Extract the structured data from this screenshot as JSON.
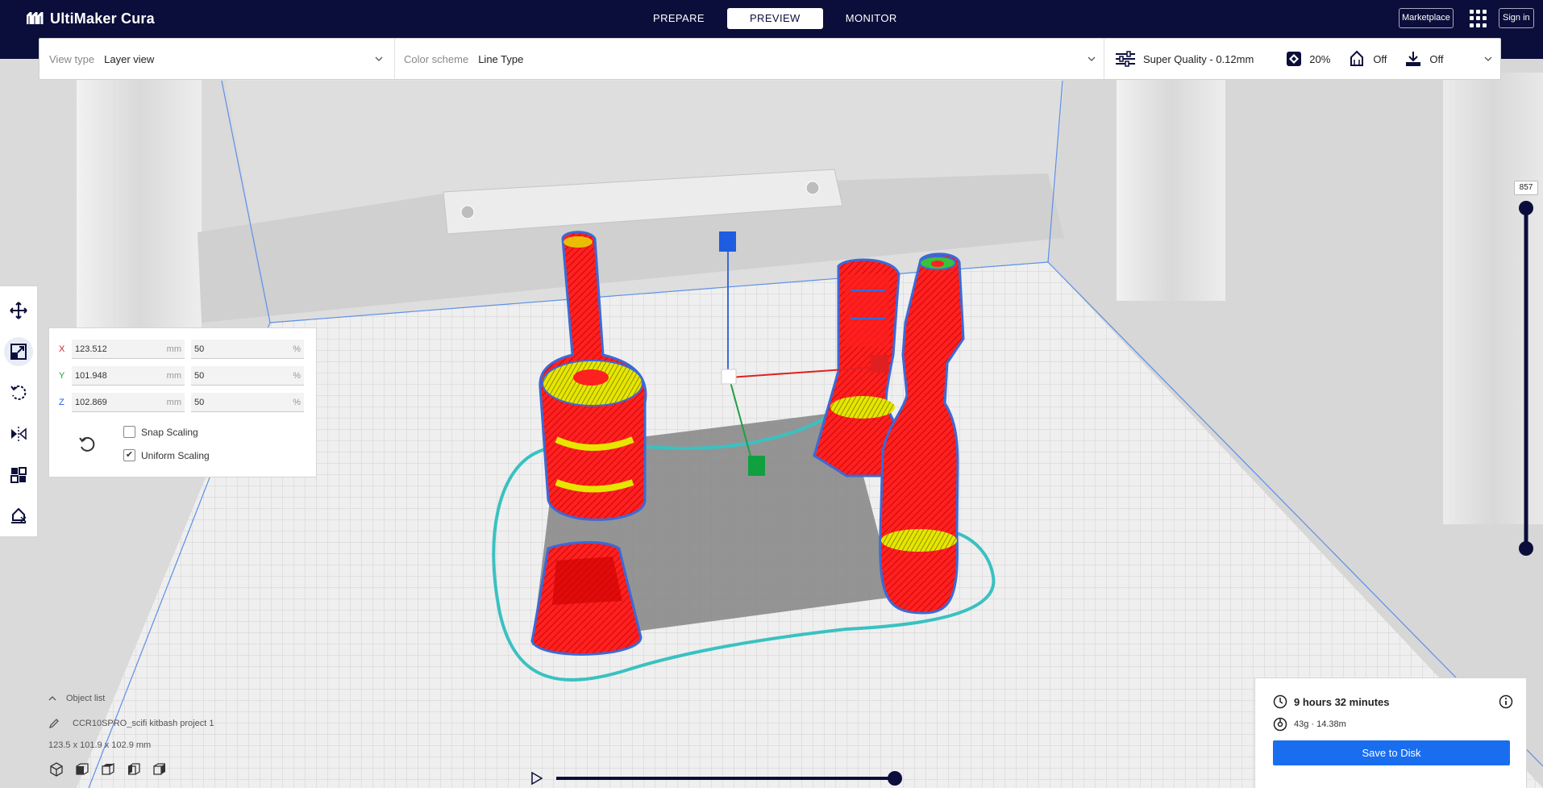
{
  "app": {
    "title": "UltiMaker Cura",
    "logo_icon": "ultimaker-logo-icon"
  },
  "stages": {
    "prepare": "PREPARE",
    "preview": "PREVIEW",
    "monitor": "MONITOR",
    "selected": "PREVIEW"
  },
  "topbar_right": {
    "marketplace": "Marketplace",
    "apps_icon": "grid-apps-icon",
    "sign_in": "Sign in"
  },
  "header": {
    "view_type_label": "View type",
    "view_type_value": "Layer view",
    "color_scheme_label": "Color scheme",
    "color_scheme_value": "Line Type",
    "profile": "Super Quality - 0.12mm",
    "infill": "20%",
    "support": "Off",
    "adhesion": "Off"
  },
  "tools": [
    "move-icon",
    "scale-icon",
    "rotate-icon",
    "mirror-icon",
    "per-model-settings-icon",
    "support-blocker-icon"
  ],
  "scale": {
    "x": {
      "axis": "X",
      "mm": "123.512",
      "mm_unit": "mm",
      "pct": "50",
      "pct_unit": "%"
    },
    "y": {
      "axis": "Y",
      "mm": "101.948",
      "mm_unit": "mm",
      "pct": "50",
      "pct_unit": "%"
    },
    "z": {
      "axis": "Z",
      "mm": "102.869",
      "mm_unit": "mm",
      "pct": "50",
      "pct_unit": "%"
    },
    "snap_scaling": "Snap Scaling",
    "snap_checked": false,
    "uniform_scaling": "Uniform Scaling",
    "uniform_checked": true,
    "uniform_check_glyph": "✔"
  },
  "layer": {
    "current": "857",
    "level": 1.0
  },
  "object_list": {
    "toggle": "Object list",
    "name": "CCR10SPRO_scifi kitbash project 1",
    "dimensions": "123.5 x 101.9 x 102.9 mm"
  },
  "print_info": {
    "time": "9 hours 32 minutes",
    "material": "43g · 14.38m",
    "save": "Save to Disk"
  },
  "colors": {
    "navy": "#0b0e3a",
    "wall": "#ff0000",
    "skin": "#e6e600",
    "skirt": "#3ac1c1",
    "accent": "#196ef0",
    "slider": "#0b0e3a"
  }
}
